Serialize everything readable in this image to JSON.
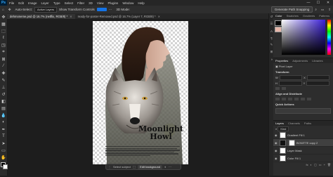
{
  "menubar": {
    "logo": "Ps",
    "items": [
      "File",
      "Edit",
      "Image",
      "Layer",
      "Type",
      "Select",
      "Filter",
      "3D",
      "View",
      "Plugins",
      "Window",
      "Help"
    ],
    "window_controls": [
      "—",
      "☐",
      "✕"
    ]
  },
  "options": {
    "auto_select_label": "Auto-Select:",
    "auto_select_value": "Active Layers",
    "show_transform_label": "Show Transform Controls",
    "mode_3d": "3D Mode:",
    "generative_fill": "Generate Path Snapping"
  },
  "tabs": [
    {
      "label": "dehmoneme.psd @ 16.7% (netflix, RGB/8) *"
    },
    {
      "label": "ready-for-poster-Removed.psd @ 16.7% (Layer 7, RGB/8) *"
    }
  ],
  "poster": {
    "title_line1": "Moonlight",
    "title_line2": "Howl"
  },
  "contextbar": {
    "select_subject": "Select subject",
    "remove_background": "Edit background"
  },
  "panel": {
    "color_tabs": [
      "Color",
      "Swatches",
      "Gradients",
      "Patterns"
    ],
    "properties_tabs": [
      "Properties",
      "Adjustments",
      "Libraries"
    ],
    "pixel_layer": "Pixel Layer",
    "transform": "Transform",
    "align": "Align and Distribute",
    "layer_label": "Layer",
    "quick_actions": "Quick Actions",
    "layers_tabs": [
      "Layers",
      "Channels",
      "Paths"
    ],
    "kind": "Kind",
    "layers": [
      {
        "name": "Gradient Fill 1"
      },
      {
        "name": "BONITTE copy 2"
      },
      {
        "name": "Layer Mask"
      },
      {
        "name": "Color Fill 1"
      }
    ],
    "footer_icons": [
      "fx",
      "◐",
      "▢",
      "▭",
      "+",
      "🗑"
    ]
  },
  "colors": {
    "accent": "#1473e6",
    "canvas_bg": "#1d1d1d"
  }
}
